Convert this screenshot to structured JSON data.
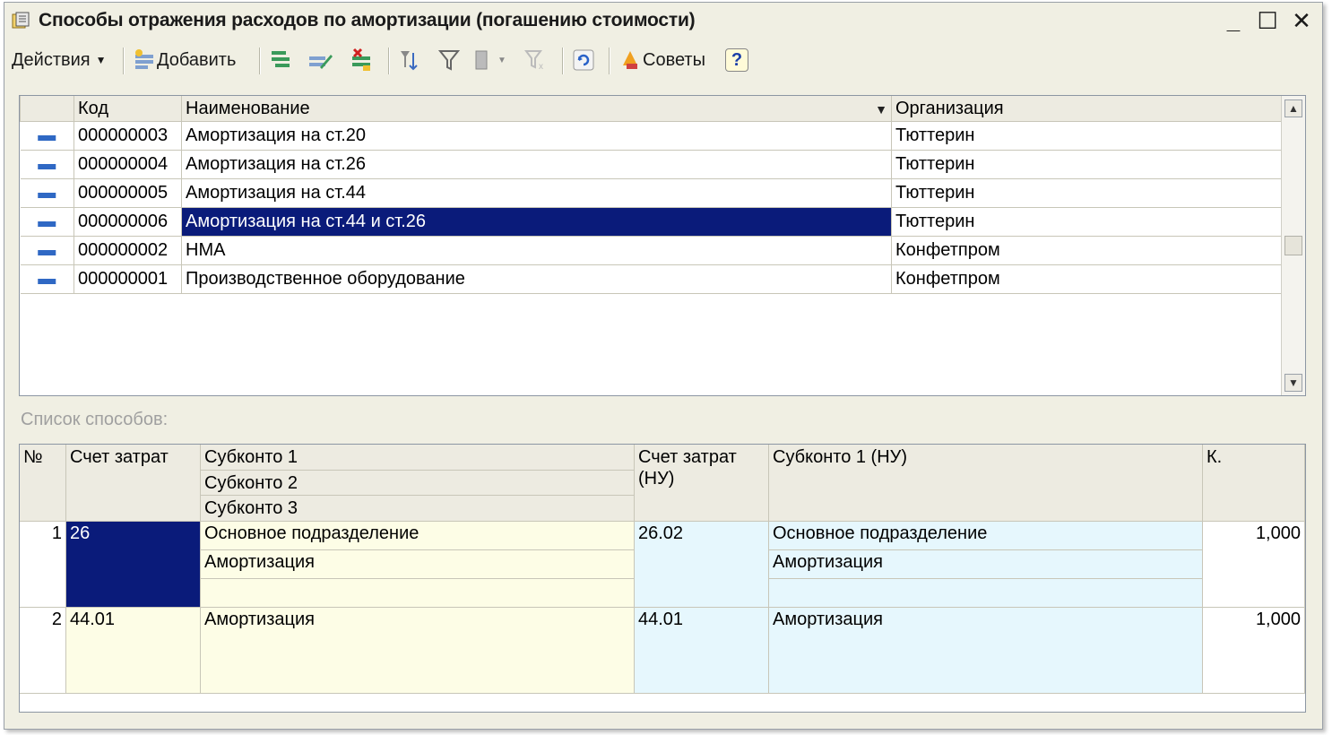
{
  "window": {
    "title": "Способы отражения расходов по амортизации (погашению стоимости)",
    "controls": {
      "minimize": "_",
      "maximize": "☐",
      "close": "✕"
    }
  },
  "toolbar": {
    "actions_label": "Действия",
    "add_label": "Добавить",
    "tips_label": "Советы",
    "help_label": "?"
  },
  "upper_table": {
    "columns": [
      "Код",
      "Наименование",
      "Организация"
    ],
    "rows": [
      {
        "code": "000000003",
        "name": "Амортизация на ст.20",
        "org": "Тюттерин",
        "selected": false
      },
      {
        "code": "000000004",
        "name": "Амортизация на ст.26",
        "org": "Тюттерин",
        "selected": false
      },
      {
        "code": "000000005",
        "name": "Амортизация на ст.44",
        "org": "Тюттерин",
        "selected": false
      },
      {
        "code": "000000006",
        "name": "Амортизация на ст.44 и ст.26",
        "org": "Тюттерин",
        "selected": true
      },
      {
        "code": "000000002",
        "name": "НМА",
        "org": "Конфетпром",
        "selected": false
      },
      {
        "code": "000000001",
        "name": "Производственное оборудование",
        "org": "Конфетпром",
        "selected": false
      }
    ]
  },
  "list_caption": "Список способов:",
  "lower_table": {
    "headers": {
      "num": "№",
      "account": "Счет затрат",
      "subconto1": "Субконто 1",
      "subconto2": "Субконто 2",
      "subconto3": "Субконто 3",
      "account_nu": "Счет затрат (НУ)",
      "subconto1_nu": "Субконто 1 (НУ)",
      "k": "К."
    },
    "rows": [
      {
        "num": "1",
        "account": "26",
        "sub1": "Основное подразделение",
        "sub2": "Амортизация",
        "sub3": "",
        "account_nu": "26.02",
        "sub1_nu": "Основное подразделение",
        "sub2_nu": "Амортизация",
        "sub3_nu": "",
        "k": "1,000"
      },
      {
        "num": "2",
        "account": "44.01",
        "sub1": "Амортизация",
        "account_nu": "44.01",
        "sub1_nu": "Амортизация",
        "k": "1,000"
      }
    ]
  },
  "colors": {
    "selection": "#0a1b7a",
    "yellow_cell": "#fdfde6",
    "blue_cell": "#e6f7fd",
    "row_marker": "#2f68c4"
  }
}
